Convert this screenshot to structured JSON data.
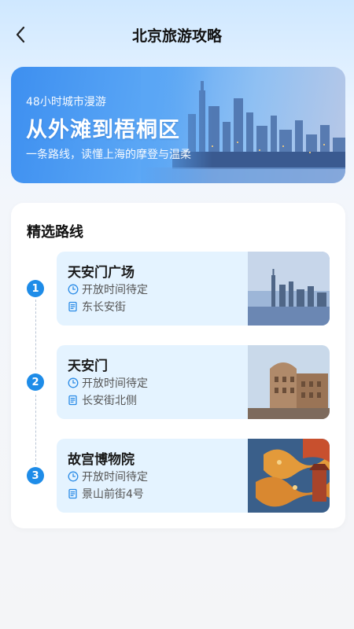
{
  "header": {
    "title": "北京旅游攻略",
    "back_icon": "chevron-left-icon"
  },
  "banner": {
    "subtitle": "48小时城市漫游",
    "title": "从外滩到梧桐区",
    "description": "一条路线，读懂上海的摩登与温柔"
  },
  "section": {
    "title": "精选路线"
  },
  "routes": [
    {
      "index": "1",
      "name": "天安门广场",
      "hours": "开放时间待定",
      "address": "东长安街"
    },
    {
      "index": "2",
      "name": "天安门",
      "hours": "开放时间待定",
      "address": "长安街北侧"
    },
    {
      "index": "3",
      "name": "故宫博物院",
      "hours": "开放时间待定",
      "address": "景山前街4号"
    }
  ],
  "colors": {
    "accent": "#1e8ce8",
    "route_bg": "#e4f3ff"
  }
}
